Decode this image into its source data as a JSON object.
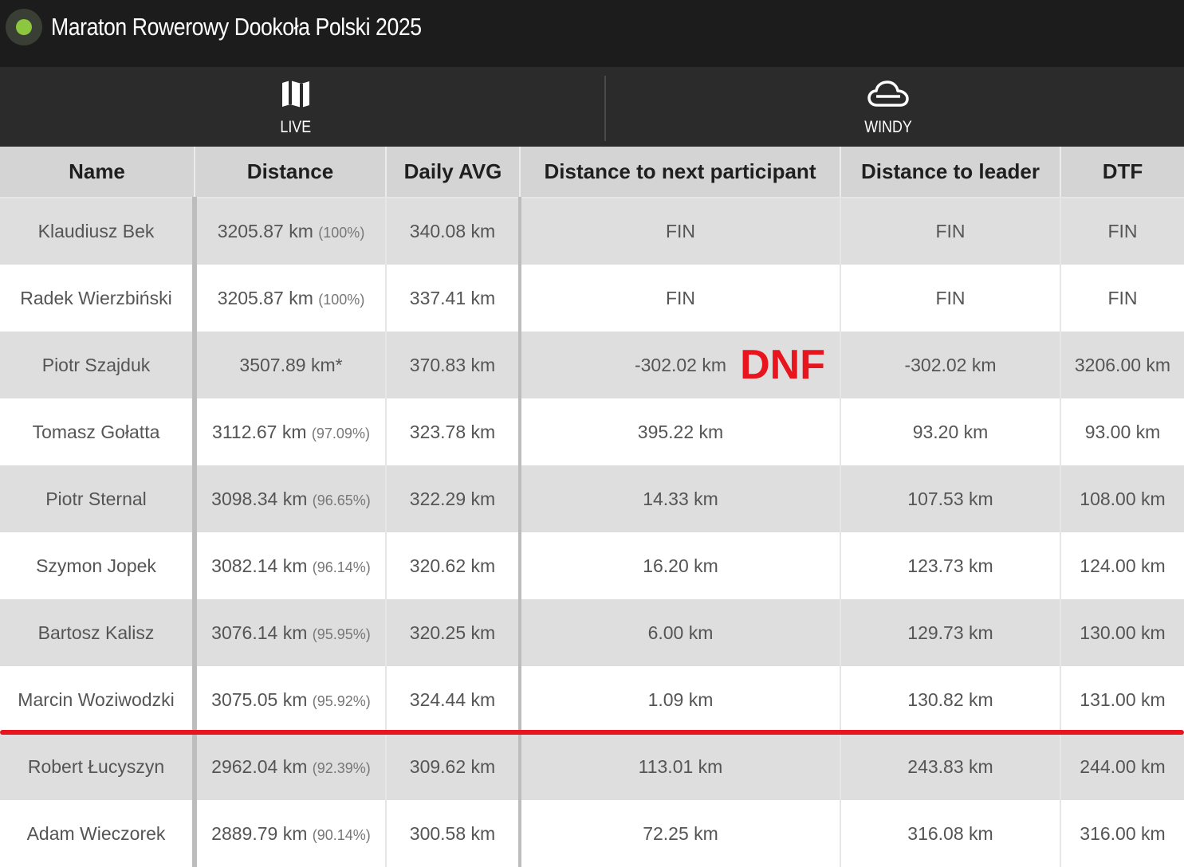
{
  "app": {
    "title": "Maraton Rowerowy Dookoła Polski 2025",
    "status_color": "#8dc63f"
  },
  "nav": {
    "items": [
      {
        "label": "LIVE",
        "icon": "map-icon"
      },
      {
        "label": "WINDY",
        "icon": "cloud-icon"
      }
    ]
  },
  "table": {
    "headers": [
      "Name",
      "Distance",
      "Daily AVG",
      "Distance to next participant",
      "Distance to leader",
      "DTF"
    ],
    "rows": [
      {
        "name": "Klaudiusz Bek",
        "distance": "3205.87 km",
        "percent": "(100%)",
        "daily_avg": "340.08 km",
        "to_next": "FIN",
        "to_leader": "FIN",
        "dtf": "FIN"
      },
      {
        "name": "Radek Wierzbiński",
        "distance": "3205.87 km",
        "percent": "(100%)",
        "daily_avg": "337.41 km",
        "to_next": "FIN",
        "to_leader": "FIN",
        "dtf": "FIN"
      },
      {
        "name": "Piotr Szajduk",
        "distance": "3507.89 km*",
        "percent": "",
        "daily_avg": "370.83 km",
        "to_next": "-302.02 km",
        "to_leader": "-302.02 km",
        "dtf": "3206.00 km",
        "annotation": "DNF"
      },
      {
        "name": "Tomasz Gołatta",
        "distance": "3112.67 km",
        "percent": "(97.09%)",
        "daily_avg": "323.78 km",
        "to_next": "395.22 km",
        "to_leader": "93.20 km",
        "dtf": "93.00 km"
      },
      {
        "name": "Piotr Sternal",
        "distance": "3098.34 km",
        "percent": "(96.65%)",
        "daily_avg": "322.29 km",
        "to_next": "14.33 km",
        "to_leader": "107.53 km",
        "dtf": "108.00 km"
      },
      {
        "name": "Szymon Jopek",
        "distance": "3082.14 km",
        "percent": "(96.14%)",
        "daily_avg": "320.62 km",
        "to_next": "16.20 km",
        "to_leader": "123.73 km",
        "dtf": "124.00 km"
      },
      {
        "name": "Bartosz Kalisz",
        "distance": "3076.14 km",
        "percent": "(95.95%)",
        "daily_avg": "320.25 km",
        "to_next": "6.00 km",
        "to_leader": "129.73 km",
        "dtf": "130.00 km"
      },
      {
        "name": "Marcin Woziwodzki",
        "distance": "3075.05 km",
        "percent": "(95.92%)",
        "daily_avg": "324.44 km",
        "to_next": "1.09 km",
        "to_leader": "130.82 km",
        "dtf": "131.00 km"
      },
      {
        "name": "Robert Łucyszyn",
        "distance": "2962.04 km",
        "percent": "(92.39%)",
        "daily_avg": "309.62 km",
        "to_next": "113.01 km",
        "to_leader": "243.83 km",
        "dtf": "244.00 km"
      },
      {
        "name": "Adam Wieczorek",
        "distance": "2889.79 km",
        "percent": "(90.14%)",
        "daily_avg": "300.58 km",
        "to_next": "72.25 km",
        "to_leader": "316.08 km",
        "dtf": "316.00 km"
      }
    ]
  },
  "colors": {
    "annotation_red": "#e8141e",
    "header_bg": "#d4d4d4",
    "row_alt_bg": "#dedede"
  }
}
